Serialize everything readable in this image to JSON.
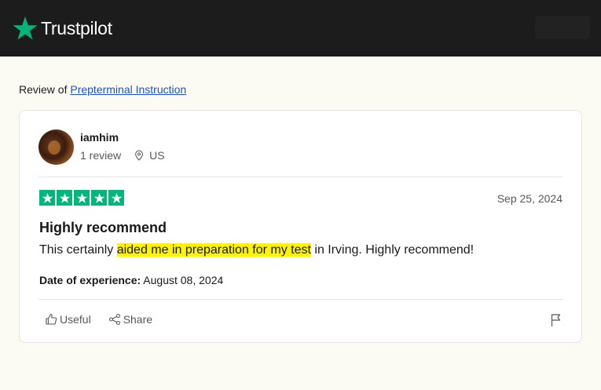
{
  "header": {
    "brand": "Trustpilot",
    "brand_color": "#00b67a"
  },
  "review_of": {
    "prefix": "Review of",
    "company": "Prepterminal Instruction"
  },
  "review": {
    "user": {
      "name": "iamhim",
      "review_count": "1 review",
      "country": "US"
    },
    "rating": 5,
    "date": "Sep 25, 2024",
    "title": "Highly recommend",
    "body": {
      "before": "This certainly ",
      "highlighted": "aided me in preparation for my test",
      "after": " in Irving. Highly recommend!"
    },
    "experience": {
      "label": "Date of experience:",
      "value": "August 08, 2024"
    },
    "actions": {
      "useful": "Useful",
      "share": "Share"
    },
    "highlight_color": "#fff400"
  }
}
